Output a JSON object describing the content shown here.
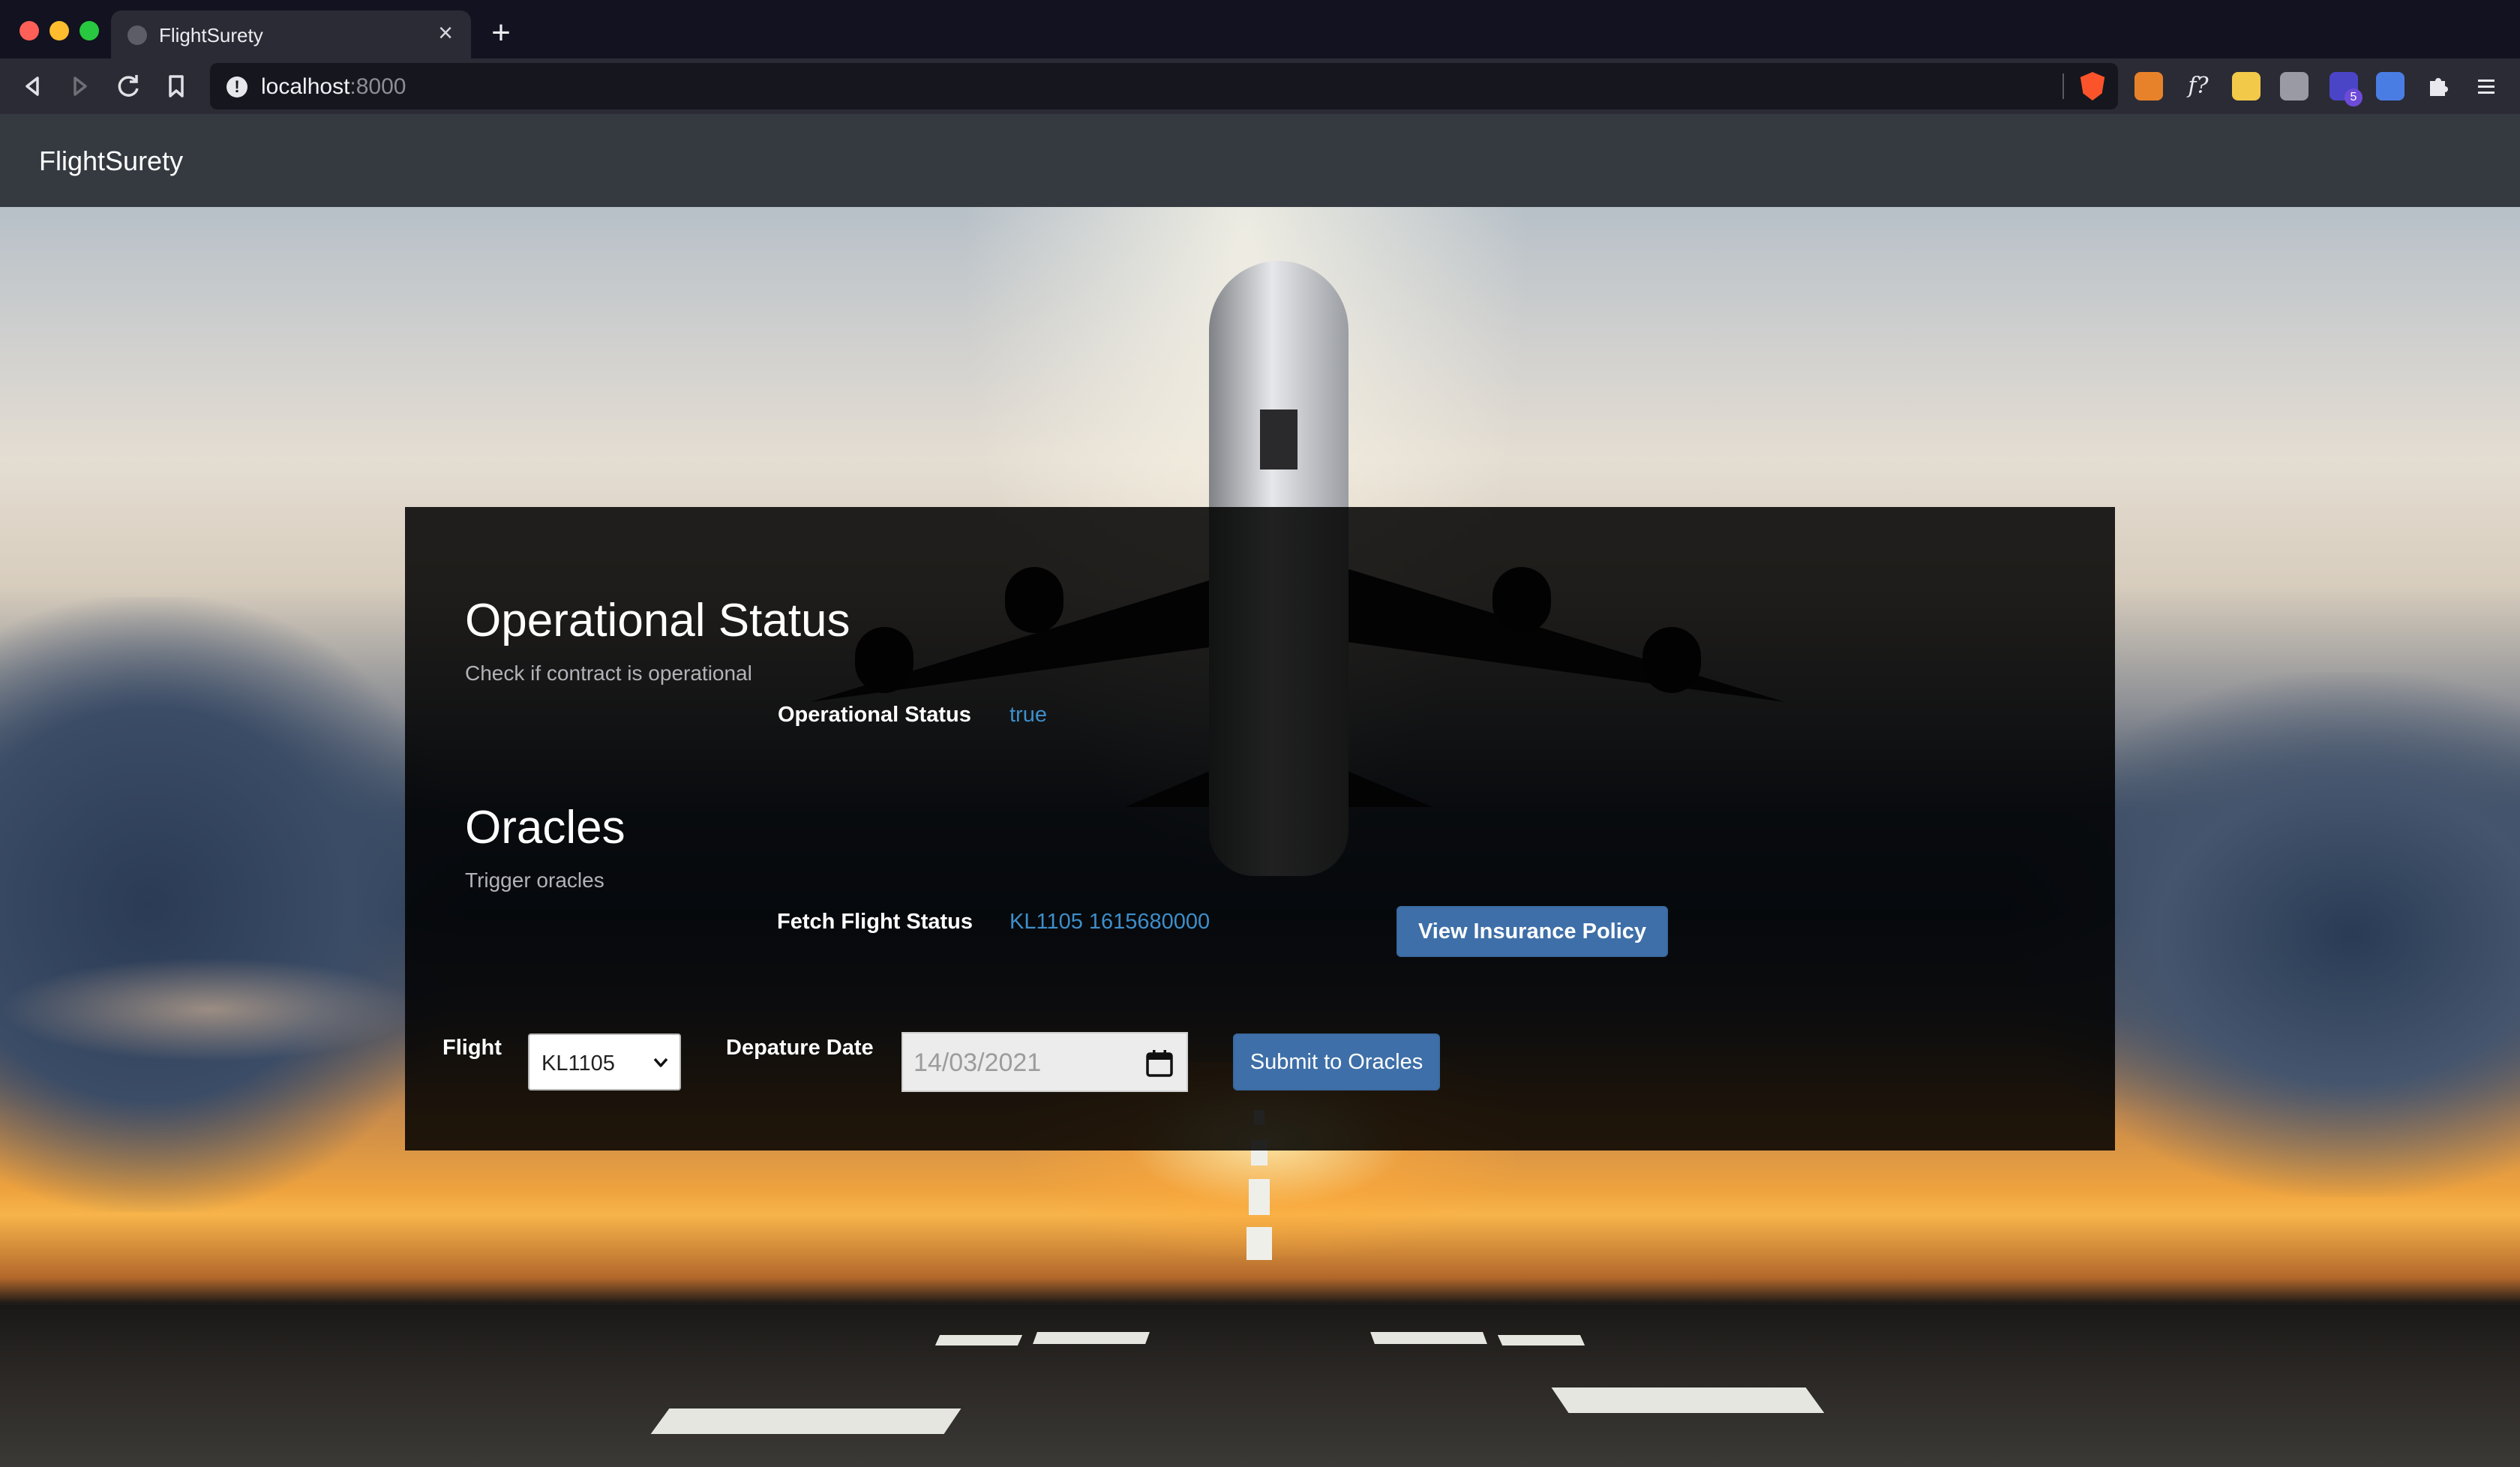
{
  "browser": {
    "tab_title": "FlightSurety",
    "tab_close": "×",
    "new_tab": "+",
    "url_host": "localhost",
    "url_port": ":8000",
    "info_icon": "!",
    "ext_f_label": "f?",
    "ext_badge": "5"
  },
  "navbar": {
    "brand": "FlightSurety"
  },
  "operational": {
    "title": "Operational Status",
    "subtitle": "Check if contract is operational",
    "label": "Operational Status",
    "value": "true"
  },
  "oracles": {
    "title": "Oracles",
    "subtitle": "Trigger oracles",
    "label": "Fetch Flight Status",
    "value": "KL1105 1615680000",
    "view_policy_button": "View Insurance Policy"
  },
  "form": {
    "flight_label": "Flight",
    "flight_selected": "KL1105",
    "date_label": "Depature Date",
    "date_value": "14/03/2021",
    "submit_button": "Submit to Oracles"
  },
  "colors": {
    "navbar_bg": "#343a40",
    "link_blue": "#3e8ec9",
    "button_blue": "#3e6fa8"
  }
}
